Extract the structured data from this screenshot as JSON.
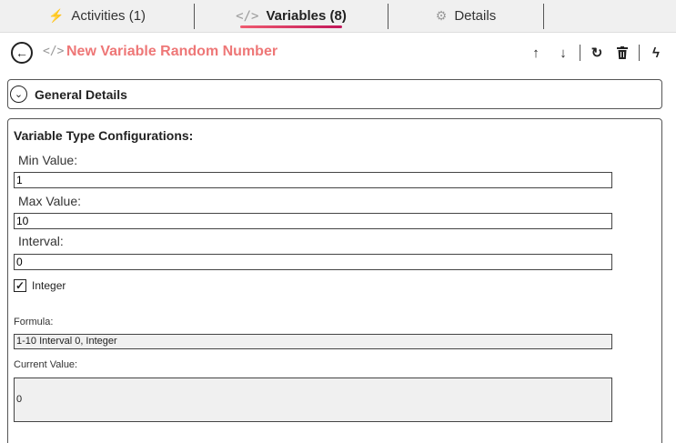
{
  "tabs": [
    {
      "label": "Activities (1)",
      "icon": "bolt-icon"
    },
    {
      "label": "Variables (8)",
      "icon": "code-icon"
    },
    {
      "label": "Details",
      "icon": "gear-icon"
    }
  ],
  "header": {
    "title": "New Variable Random Number",
    "title_color": "#ee7777"
  },
  "sections": {
    "general_details": "General Details",
    "config_title": "Variable Type Configurations:"
  },
  "fields": {
    "min_label": "Min Value:",
    "min_value": "1",
    "max_label": "Max Value:",
    "max_value": "10",
    "interval_label": "Interval:",
    "interval_value": "0",
    "integer_label": "Integer",
    "integer_checked": true,
    "formula_label": "Formula:",
    "formula_value": "1-10 Interval 0, Integer",
    "current_label": "Current Value:",
    "current_value": "0"
  },
  "colors": {
    "accent_gradient_start": "#ef5a6f",
    "accent_gradient_end": "#c2185b"
  }
}
